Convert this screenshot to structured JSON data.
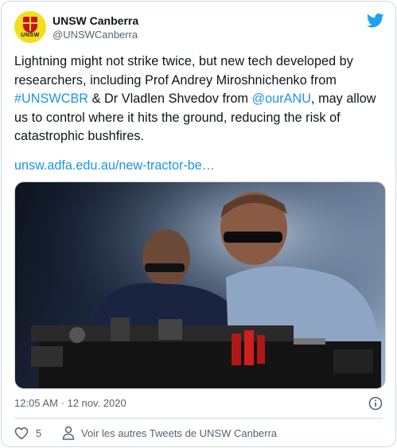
{
  "author": {
    "name": "UNSW Canberra",
    "handle": "@UNSWCanberra",
    "avatar_text": "UNSW"
  },
  "tweet": {
    "text_parts": {
      "p1": "Lightning might not strike twice, but new tech developed by researchers, including Prof Andrey Miroshnichenko from ",
      "hashtag": "#UNSWCBR",
      "p2": " & Dr Vladlen Shvedov from ",
      "mention": "@ourANU",
      "p3": ", may allow us to control where it hits the ground, reducing the risk of catastrophic bushfires."
    },
    "url": "unsw.adfa.edu.au/new-tractor-be…",
    "timestamp": "12:05 AM · 12 nov. 2020"
  },
  "actions": {
    "like_count": "5",
    "more_tweets_label": "Voir les autres Tweets de UNSW Canberra"
  },
  "icons": {
    "brand": "twitter-bird-icon",
    "info": "info-icon",
    "like": "heart-icon",
    "user": "user-icon"
  },
  "colors": {
    "link": "#1b95e0",
    "twitter_blue": "#1da1f2",
    "avatar_bg": "#f4dd1a",
    "muted": "#536471"
  }
}
